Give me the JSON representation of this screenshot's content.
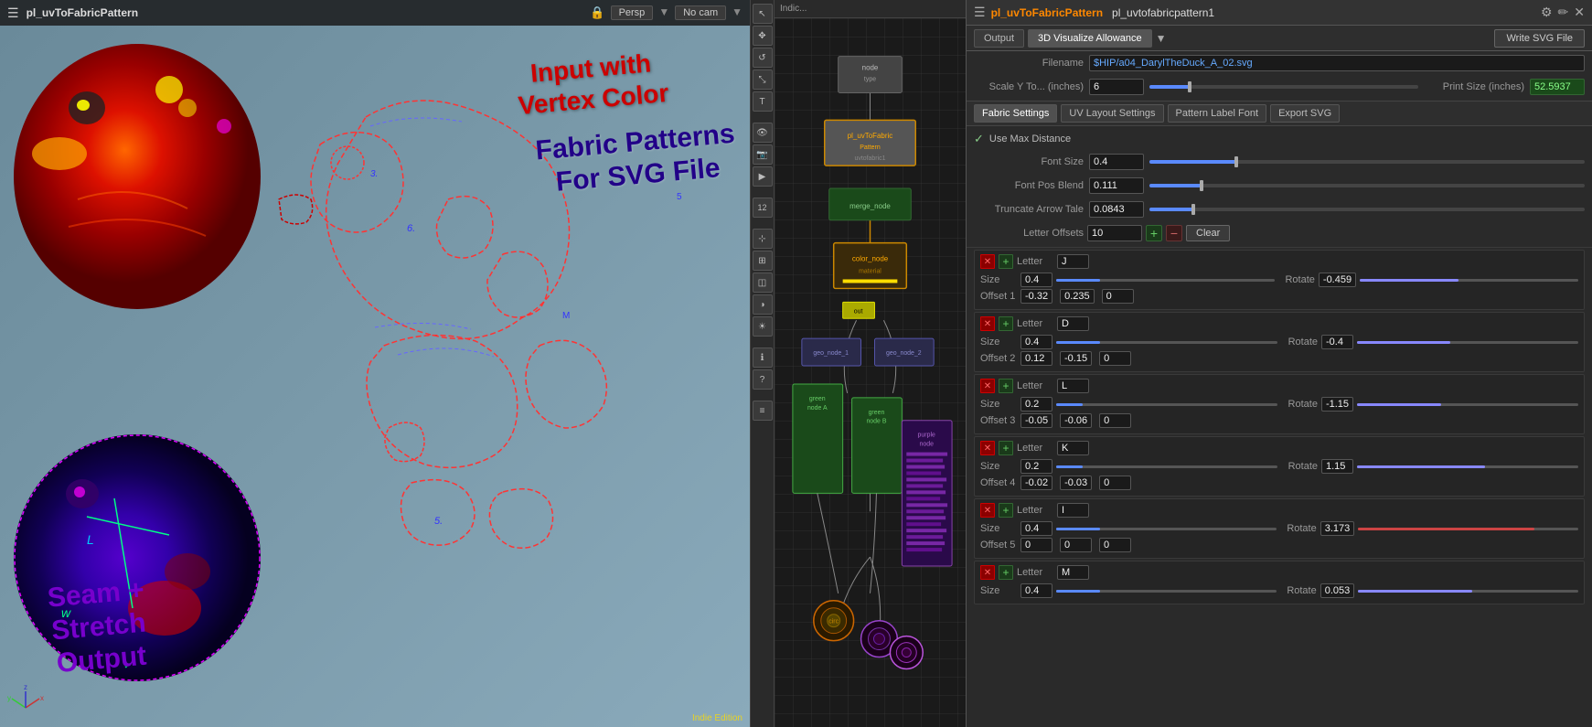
{
  "app": {
    "title": "pl_uvToFabricPattern"
  },
  "viewport": {
    "title": "pl_uvToFabricPattern",
    "menu_persp": "Persp",
    "menu_cam": "No cam",
    "overlay_text1": "Input with\nVertex Color",
    "overlay_text2": "Fabric Patterns\nFor SVG File",
    "overlay_text3": "Seam +\nStretch\nOutput",
    "bottom_label": "Indie Edition"
  },
  "node_editor": {
    "header": "Indic..."
  },
  "right_panel": {
    "node_name": "pl_uvToFabricPattern",
    "node_title": "pl_uvtofabricpattern1",
    "tabs": {
      "output": "Output",
      "visualize": "3D Visualize Allowance",
      "write_svg": "Write SVG File"
    },
    "filename_label": "Filename",
    "filename_value": "$HIP/a04_DarylTheDuck_A_02.svg",
    "scale_y_label": "Scale Y To... (inches)",
    "scale_y_value": "6",
    "print_size_label": "Print Size (inches)",
    "print_size_value": "52.5937",
    "section_buttons": [
      "Fabric Settings",
      "UV Layout Settings",
      "Pattern Label Font",
      "Export SVG"
    ],
    "use_max_distance": "Use Max Distance",
    "font_size_label": "Font Size",
    "font_size_value": "0.4",
    "font_pos_blend_label": "Font Pos Blend",
    "font_pos_blend_value": "0.111",
    "truncate_arrow_label": "Truncate Arrow Tale",
    "truncate_arrow_value": "0.0843",
    "letter_offsets_label": "Letter Offsets",
    "letter_offsets_value": "10",
    "clear_label": "Clear",
    "letters": [
      {
        "id": "J",
        "size": "0.4",
        "rotate": "-0.459",
        "offset_label": "Offset 1",
        "offset_x": "-0.32",
        "offset_y": "0.235",
        "offset_z": "0"
      },
      {
        "id": "D",
        "size": "0.4",
        "rotate": "-0.4",
        "offset_label": "Offset 2",
        "offset_x": "0.12",
        "offset_y": "-0.15",
        "offset_z": "0"
      },
      {
        "id": "L",
        "size": "0.2",
        "rotate": "-1.15",
        "offset_label": "Offset 3",
        "offset_x": "-0.05",
        "offset_y": "-0.06",
        "offset_z": "0"
      },
      {
        "id": "K",
        "size": "0.2",
        "rotate": "1.15",
        "offset_label": "Offset 4",
        "offset_x": "-0.02",
        "offset_y": "-0.03",
        "offset_z": "0"
      },
      {
        "id": "I",
        "size": "0.4",
        "rotate": "3.173",
        "offset_label": "Offset 5",
        "offset_x": "0",
        "offset_y": "0",
        "offset_z": "0"
      },
      {
        "id": "M",
        "size": "0.4",
        "rotate": "0.053",
        "offset_label": "",
        "offset_x": "",
        "offset_y": "",
        "offset_z": ""
      }
    ]
  }
}
